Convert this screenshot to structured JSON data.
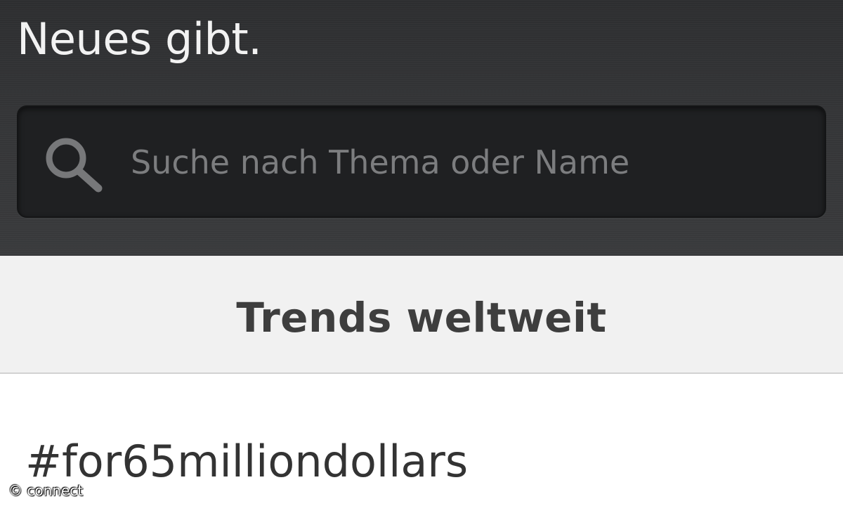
{
  "header": {
    "intro_text": "Neues gibt."
  },
  "search": {
    "placeholder": "Suche nach Thema oder Name",
    "value": "",
    "icon": "search-icon"
  },
  "trends": {
    "title": "Trends weltweit",
    "items": [
      {
        "label": "#for65milliondollars"
      }
    ]
  },
  "watermark": {
    "text": "© connect"
  },
  "colors": {
    "panel_background": "#353638",
    "search_field": "#1f2022",
    "section_header": "#f1f1f1",
    "title_text": "#3e3e3e"
  }
}
